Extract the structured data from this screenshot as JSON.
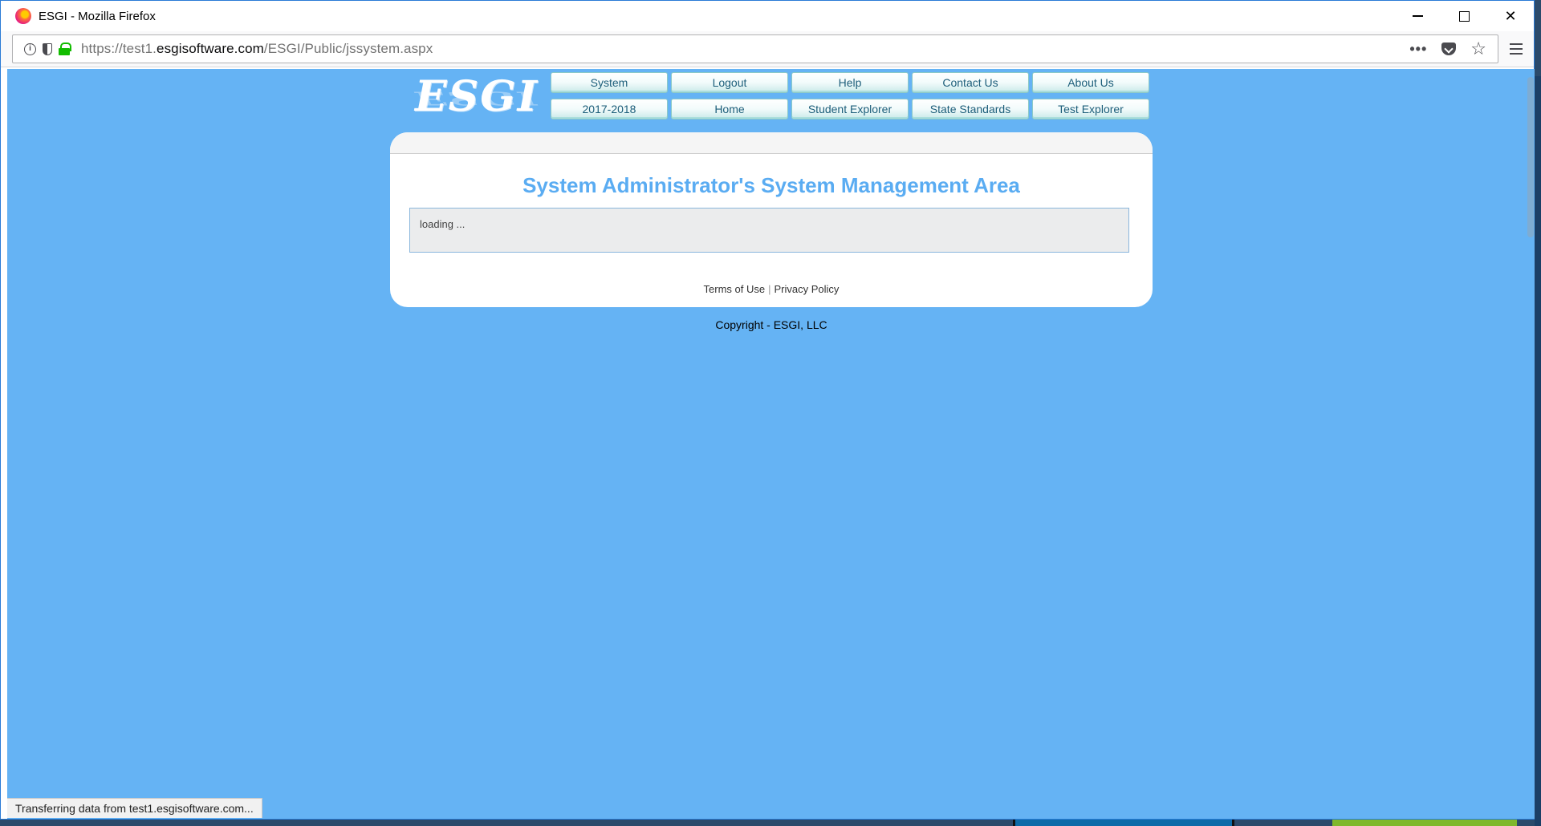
{
  "window": {
    "title": "ESGI - Mozilla Firefox",
    "controls": {
      "minimize": "–",
      "close": "✕"
    }
  },
  "urlbar": {
    "prefix": "https://test1.",
    "host": "esgisoftware.com",
    "path": "/ESGI/Public/jssystem.aspx",
    "icons": [
      "info-icon",
      "tracking-shield-icon",
      "lock-icon",
      "page-actions-icon",
      "pocket-icon",
      "bookmark-star-icon",
      "hamburger-menu-icon"
    ]
  },
  "logo": {
    "text": "ESGI"
  },
  "nav": {
    "row1": [
      "System",
      "Logout",
      "Help",
      "Contact Us",
      "About Us"
    ],
    "row2": [
      "2017-2018",
      "Home",
      "Student Explorer",
      "State Standards",
      "Test Explorer"
    ]
  },
  "panel": {
    "title": "System Administrator's System Management Area",
    "loading_text": "loading ..."
  },
  "footer": {
    "terms": "Terms of Use",
    "separator": "|",
    "privacy": "Privacy Policy",
    "copyright": "Copyright - ESGI, LLC"
  },
  "status_bar": {
    "text": "Transferring data from test1.esgisoftware.com..."
  },
  "colors": {
    "page_background": "#65b3f4",
    "title_color": "#5aacf2",
    "nav_text": "#1d5e7a"
  }
}
